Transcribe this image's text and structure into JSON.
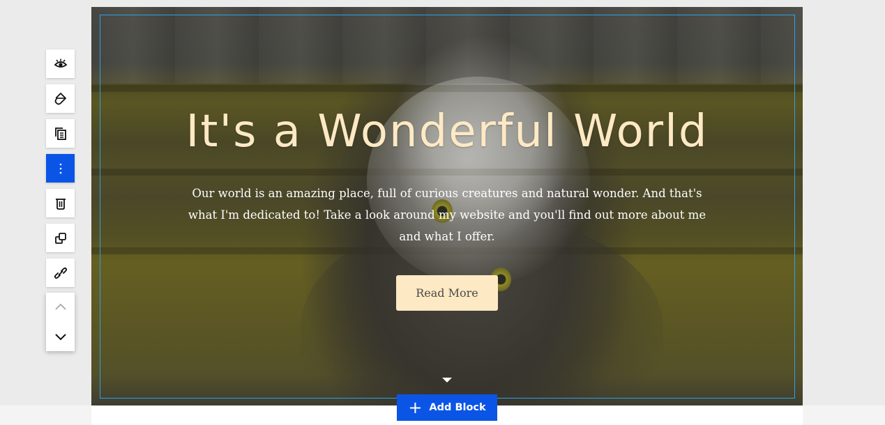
{
  "hero": {
    "title": "It's a Wonderful World",
    "body": "Our world is an amazing place, full of curious creatures and natural wonder. And that's what I'm dedicated to! Take a look around my website and you'll find out more about me and what I offer.",
    "button_label": "Read More",
    "title_color": "#fde9c4",
    "button_color": "#fde9c4"
  },
  "editor": {
    "add_block_label": "Add Block",
    "add_block_icon": "plus-icon",
    "accent_color": "#0b55e6",
    "selection_color": "#2aa3e6"
  },
  "toolbar": {
    "items": [
      {
        "name": "visibility",
        "icon": "eye-icon"
      },
      {
        "name": "design",
        "icon": "paint-bucket-icon"
      },
      {
        "name": "copy",
        "icon": "copy-icon"
      },
      {
        "name": "more",
        "icon": "vertical-dots-icon",
        "active": true
      },
      {
        "name": "delete",
        "icon": "trash-icon"
      },
      {
        "name": "duplicate",
        "icon": "duplicate-icon"
      },
      {
        "name": "link",
        "icon": "link-icon"
      },
      {
        "name": "move-up",
        "icon": "chevron-up-icon"
      },
      {
        "name": "move-down",
        "icon": "chevron-down-icon"
      }
    ]
  }
}
